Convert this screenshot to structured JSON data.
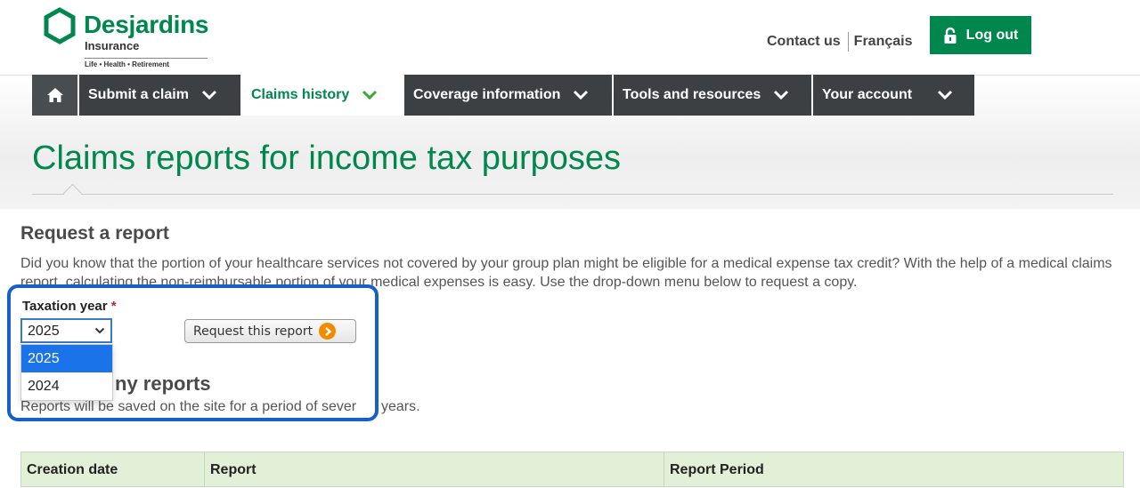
{
  "brand": {
    "name": "Desjardins",
    "sub": "Insurance",
    "tagline": "Life • Health • Retirement",
    "color": "#00874e"
  },
  "header": {
    "contact_label": "Contact us",
    "language_label": "Français",
    "logout_label": "Log out"
  },
  "nav": {
    "items": [
      {
        "label": "Submit a claim"
      },
      {
        "label": "Claims history",
        "active": true
      },
      {
        "label": "Coverage information"
      },
      {
        "label": "Tools and resources"
      },
      {
        "label": "Your account"
      }
    ]
  },
  "page": {
    "title": "Claims reports for income tax purposes"
  },
  "request": {
    "heading": "Request a report",
    "intro": "Did you know that the portion of your healthcare services not covered by your group plan might be eligible for a medical expense tax credit? With the help of a medical claims report, calculating the non-reimbursable portion of your medical expenses is easy. Use the drop-down menu below to request a copy.",
    "year_label": "Taxation year",
    "required_mark": "*",
    "selected_year": "2025",
    "year_options": [
      "2025",
      "2024"
    ],
    "button_label": "Request this report"
  },
  "my_reports": {
    "heading": "My reports",
    "heading_visible": "ny reports",
    "note": "Reports will be saved on the site for a period of seven years.",
    "note_visible": "Reports will be saved on the site for a period of sever",
    "note_tail": "years.",
    "columns": [
      "Creation date",
      "Report",
      "Report Period"
    ]
  }
}
